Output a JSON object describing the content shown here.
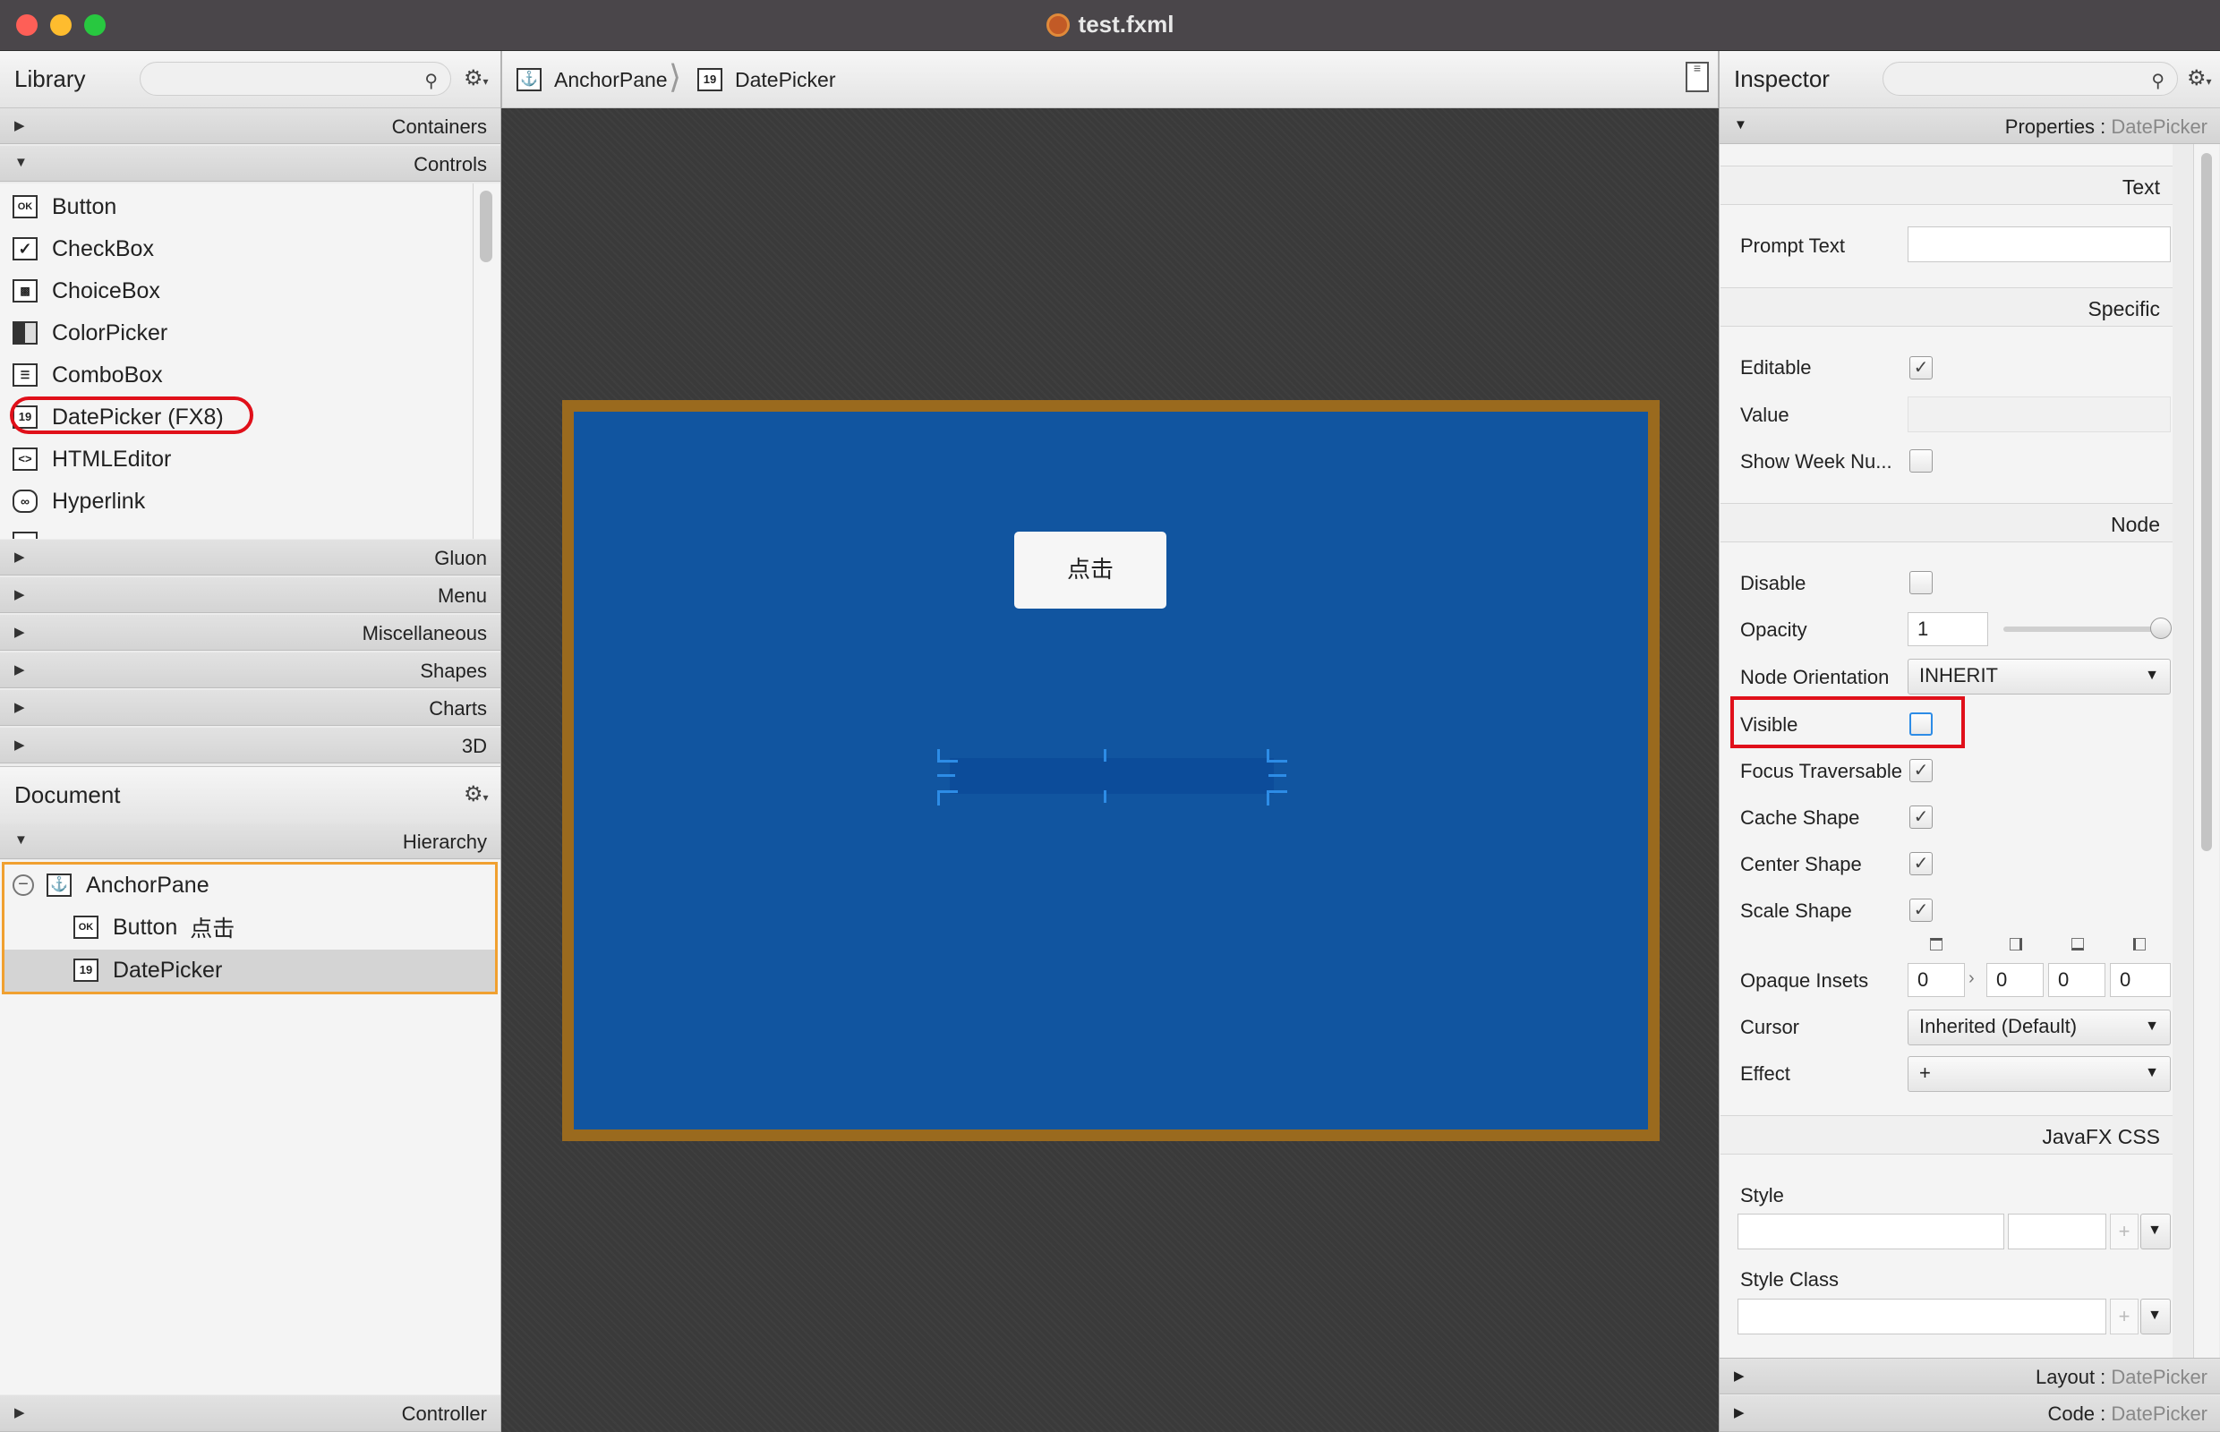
{
  "window": {
    "title": "test.fxml"
  },
  "library": {
    "title": "Library",
    "sections_top": [
      {
        "label": "Containers",
        "expanded": false
      },
      {
        "label": "Controls",
        "expanded": true
      }
    ],
    "controls": [
      {
        "label": "Button",
        "icon": "OK"
      },
      {
        "label": "CheckBox",
        "icon": "check"
      },
      {
        "label": "ChoiceBox",
        "icon": "choice"
      },
      {
        "label": "ColorPicker",
        "icon": "color"
      },
      {
        "label": "ComboBox",
        "icon": "combo"
      },
      {
        "label": "DatePicker  (FX8)",
        "icon": "19"
      },
      {
        "label": "HTMLEditor",
        "icon": "<>"
      },
      {
        "label": "Hyperlink",
        "icon": "link"
      }
    ],
    "sections_bottom": [
      "Gluon",
      "Menu",
      "Miscellaneous",
      "Shapes",
      "Charts",
      "3D"
    ]
  },
  "document": {
    "title": "Document",
    "hierarchy_label": "Hierarchy",
    "tree": {
      "root": "AnchorPane",
      "children": [
        {
          "type": "Button",
          "text": "点击",
          "icon": "OK"
        },
        {
          "type": "DatePicker",
          "icon": "19"
        }
      ]
    },
    "controller_label": "Controller"
  },
  "breadcrumb": {
    "items": [
      {
        "label": "AnchorPane"
      },
      {
        "label": "DatePicker"
      }
    ]
  },
  "canvas": {
    "button_text": "点击",
    "pane_color": "#1155a0",
    "pane_border_color": "#9a6a1e"
  },
  "inspector": {
    "title": "Inspector",
    "properties_header": {
      "prefix": "Properties :",
      "target": "DatePicker"
    },
    "text_section": "Text",
    "prompt_text_label": "Prompt Text",
    "prompt_text_value": "",
    "specific_section": "Specific",
    "editable_label": "Editable",
    "editable": true,
    "value_label": "Value",
    "show_week_label": "Show Week Nu...",
    "show_week": false,
    "node_section": "Node",
    "disable_label": "Disable",
    "disable": false,
    "opacity_label": "Opacity",
    "opacity_value": "1",
    "opacity_fraction": 1.0,
    "orientation_label": "Node Orientation",
    "orientation_value": "INHERIT",
    "visible_label": "Visible",
    "visible": false,
    "focus_label": "Focus Traversable",
    "focus": true,
    "cache_label": "Cache Shape",
    "cache": true,
    "center_label": "Center Shape",
    "center": true,
    "scale_label": "Scale Shape",
    "scale": true,
    "insets_label": "Opaque Insets",
    "insets": [
      "0",
      "0",
      "0",
      "0"
    ],
    "cursor_label": "Cursor",
    "cursor_value": "Inherited (Default)",
    "effect_label": "Effect",
    "effect_value": "+",
    "css_section": "JavaFX CSS",
    "style_label": "Style",
    "style_class_label": "Style Class",
    "layout_header": {
      "prefix": "Layout :",
      "target": "DatePicker"
    },
    "code_header": {
      "prefix": "Code :",
      "target": "DatePicker"
    }
  },
  "colors": {
    "highlight_red": "#e0101a",
    "selection_orange": "#f0a030",
    "accent_blue": "#2d8ce6"
  }
}
